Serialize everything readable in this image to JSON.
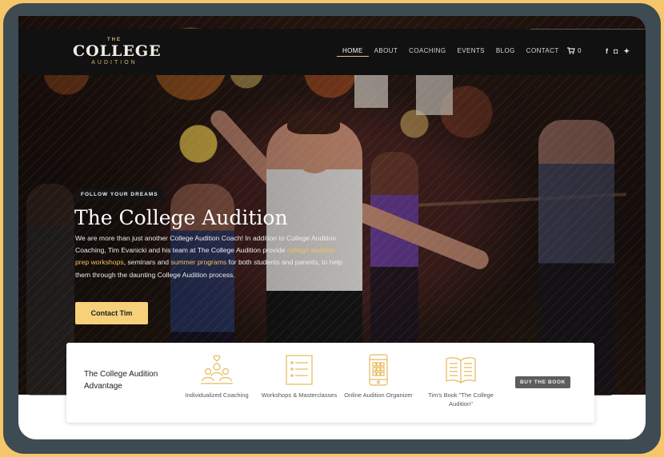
{
  "colors": {
    "background": "#f6c66a",
    "frame": "#3e4b52",
    "accent": "#f6d17a",
    "highlight": "#f4c05a",
    "nav": "#111111",
    "icon": "#e6b95c"
  },
  "logo": {
    "the": "THE",
    "college": "COLLEGE",
    "audition": "AUDITION"
  },
  "nav": {
    "items": [
      {
        "label": "HOME",
        "active": true
      },
      {
        "label": "ABOUT"
      },
      {
        "label": "COACHING"
      },
      {
        "label": "EVENTS"
      },
      {
        "label": "BLOG"
      },
      {
        "label": "CONTACT"
      }
    ],
    "cart_icon": "cart-icon",
    "cart_count": "0",
    "social": [
      {
        "icon": "facebook-icon",
        "glyph": "f"
      },
      {
        "icon": "instagram-icon",
        "glyph": "◘"
      },
      {
        "icon": "twitter-icon",
        "glyph": "✦"
      }
    ]
  },
  "hero": {
    "eyebrow": "FOLLOW YOUR DREAMS",
    "title": "The College Audition",
    "body_1": "We are more than just another College Audition Coach! In addition to College Audition Coaching, Tim Evanicki and his team at The College Audition provide ",
    "link_1": "college audition prep workshops",
    "body_2": ", seminars and ",
    "link_2": "summer programs",
    "body_3": " for both students and parents, to help them through the daunting College Audition process.",
    "cta": "Contact Tim"
  },
  "advantage": {
    "title": "The College Audition Advantage",
    "features": [
      {
        "icon": "people-icon",
        "label": "Individualized Coaching"
      },
      {
        "icon": "checklist-icon",
        "label": "Workshops & Masterclasses"
      },
      {
        "icon": "phone-organizer-icon",
        "label": "Online Audition Organizer"
      },
      {
        "icon": "book-icon",
        "label": "Tim's Book \"The College Audition\""
      }
    ],
    "button": "BUY THE BOOK"
  }
}
